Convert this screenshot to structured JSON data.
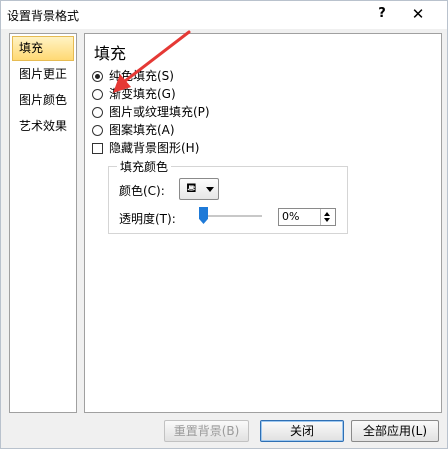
{
  "window": {
    "title": "设置背景格式",
    "help_label": "?",
    "close_label": "✕"
  },
  "sidebar": {
    "items": [
      {
        "label": "填充",
        "selected": true
      },
      {
        "label": "图片更正",
        "selected": false
      },
      {
        "label": "图片颜色",
        "selected": false
      },
      {
        "label": "艺术效果",
        "selected": false
      }
    ]
  },
  "fill": {
    "section_title": "填充",
    "options": [
      {
        "label": "纯色填充(S)",
        "checked": true
      },
      {
        "label": "渐变填充(G)",
        "checked": false
      },
      {
        "label": "图片或纹理填充(P)",
        "checked": false
      },
      {
        "label": "图案填充(A)",
        "checked": false
      }
    ],
    "hide_bg_graphics": {
      "label": "隐藏背景图形(H)",
      "checked": false
    },
    "fill_color_group": {
      "legend": "填充颜色",
      "color_label": "颜色(C):",
      "transparency_label": "透明度(T):",
      "transparency_value": "0%"
    }
  },
  "buttons": {
    "reset": "重置背景(B)",
    "close": "关闭",
    "apply_all": "全部应用(L)"
  },
  "colors": {
    "accent": "#1e7ad8",
    "annotation_arrow": "#e53935",
    "selected_item": "#ffd974"
  }
}
